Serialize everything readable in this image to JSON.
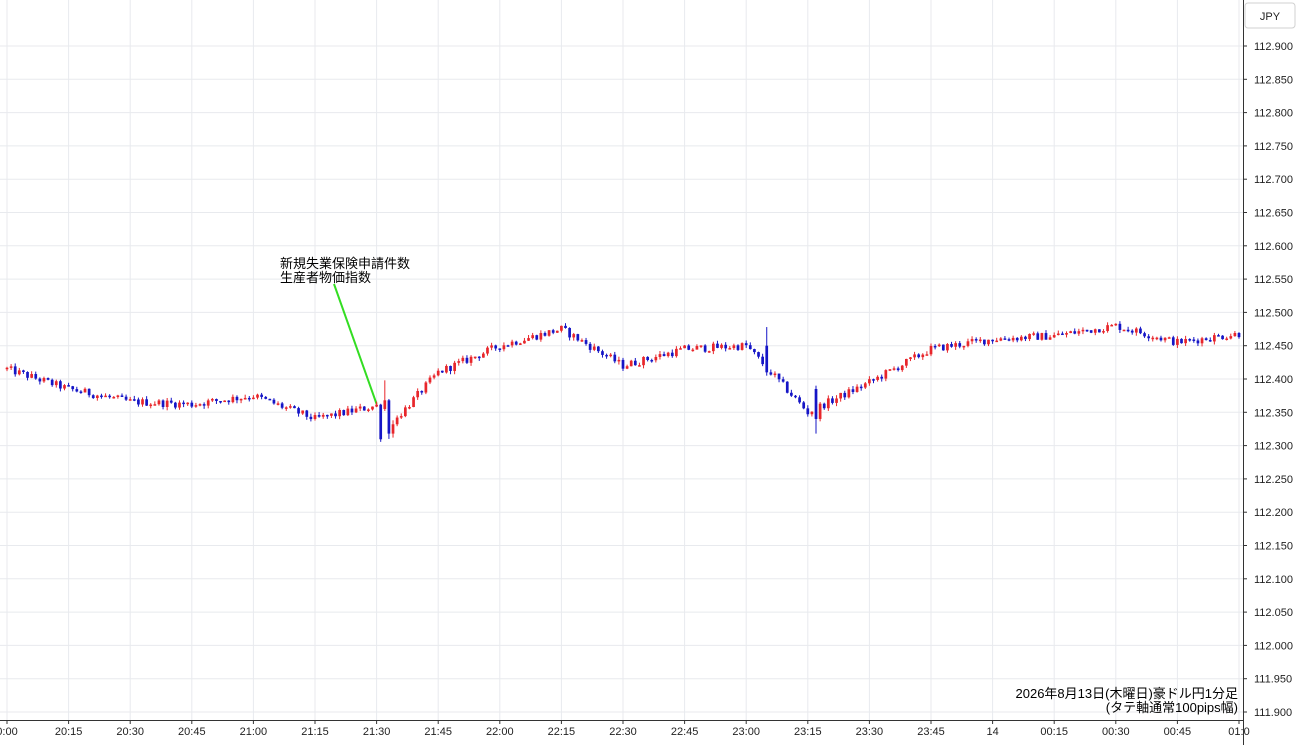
{
  "chart_data": {
    "type": "candlestick",
    "title": "2026年8月13日(木曜日)豪ドル円1分足",
    "subtitle": "(タテ軸通常100pips幅)",
    "currency": "JPY",
    "grid": true,
    "x_tick_labels": [
      "0:00",
      "20:15",
      "20:30",
      "20:45",
      "21:00",
      "21:15",
      "21:30",
      "21:45",
      "22:00",
      "22:15",
      "22:30",
      "22:45",
      "23:00",
      "23:15",
      "23:30",
      "23:45",
      "14",
      "00:15",
      "00:30",
      "00:45",
      "01:0"
    ],
    "y_ticks": [
      "112.900",
      "112.850",
      "112.800",
      "112.750",
      "112.700",
      "112.650",
      "112.600",
      "112.550",
      "112.500",
      "112.450",
      "112.400",
      "112.350",
      "112.300",
      "112.250",
      "112.200",
      "112.150",
      "112.100",
      "112.050",
      "112.000",
      "111.950",
      "111.900"
    ],
    "ylim": [
      111.885,
      112.92
    ],
    "colors": {
      "up": "#e8262b",
      "down": "#1515c6",
      "annotation_line": "#33dd22",
      "grid": "#e8eaee"
    },
    "annotation": {
      "lines": [
        "新規失業保険申請件数",
        "生産者物価指数"
      ],
      "time": "21:30"
    },
    "series": [
      {
        "x": "20:00",
        "approx_close": 112.415
      },
      {
        "x": "20:15",
        "approx_close": 112.385
      },
      {
        "x": "20:30",
        "approx_close": 112.366
      },
      {
        "x": "20:45",
        "approx_close": 112.362
      },
      {
        "x": "21:00",
        "approx_close": 112.375
      },
      {
        "x": "21:15",
        "approx_close": 112.34
      },
      {
        "x": "21:30",
        "approx_close": 112.36
      },
      {
        "x": "21:31",
        "approx_close": 112.315
      },
      {
        "x": "21:45",
        "approx_close": 112.41
      },
      {
        "x": "22:00",
        "approx_close": 112.45
      },
      {
        "x": "22:15",
        "approx_close": 112.475
      },
      {
        "x": "22:30",
        "approx_close": 112.42
      },
      {
        "x": "22:45",
        "approx_close": 112.445
      },
      {
        "x": "23:00",
        "approx_close": 112.45
      },
      {
        "x": "23:15",
        "approx_close": 112.35
      },
      {
        "x": "23:30",
        "approx_close": 112.395
      },
      {
        "x": "23:45",
        "approx_close": 112.445
      },
      {
        "x": "00:00",
        "approx_close": 112.46
      },
      {
        "x": "00:15",
        "approx_close": 112.465
      },
      {
        "x": "00:30",
        "approx_close": 112.48
      },
      {
        "x": "00:45",
        "approx_close": 112.455
      },
      {
        "x": "01:00",
        "approx_close": 112.468
      }
    ]
  }
}
